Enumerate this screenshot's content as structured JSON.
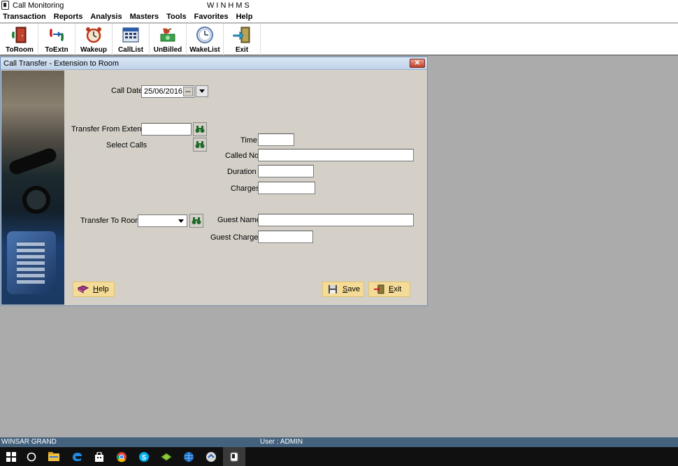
{
  "app": {
    "title": "Call Monitoring",
    "center_title": "WINHMS"
  },
  "menu": [
    "Transaction",
    "Reports",
    "Analysis",
    "Masters",
    "Tools",
    "Favorites",
    "Help"
  ],
  "toolbar": [
    {
      "label": "ToRoom",
      "icon": "transfer-to-room-icon"
    },
    {
      "label": "ToExtn",
      "icon": "transfer-to-extension-icon"
    },
    {
      "label": "Wakeup",
      "icon": "alarm-clock-icon"
    },
    {
      "label": "CallList",
      "icon": "calculator-list-icon"
    },
    {
      "label": "UnBilled",
      "icon": "unbilled-money-icon"
    },
    {
      "label": "WakeList",
      "icon": "clock-icon"
    },
    {
      "label": "Exit",
      "icon": "exit-door-icon"
    }
  ],
  "dialog": {
    "title": "Call Transfer - Extension to Room",
    "call_date_label": "Call Date",
    "call_date_value": "25/06/2016",
    "date_button": "...",
    "transfer_from_label": "Transfer From Extension",
    "transfer_from_value": "",
    "select_calls_label": "Select Calls",
    "time_label": "Time",
    "time_value": "",
    "called_no_label": "Called No",
    "called_no_value": "",
    "duration_label": "Duration",
    "duration_value": "",
    "charges_label": "Charges",
    "charges_value": "",
    "transfer_to_label": "Transfer To  Room",
    "transfer_to_value": "",
    "guest_name_label": "Guest Name",
    "guest_name_value": "",
    "guest_charges_label": "Guest Charges",
    "guest_charges_value": "",
    "help_first": "H",
    "help_rest": "elp",
    "save_first": "S",
    "save_rest": "ave",
    "exit_first": "E",
    "exit_rest": "xit"
  },
  "status": {
    "company": "WINSAR GRAND",
    "user": "User :  ADMIN"
  },
  "taskbar": [
    "start-windows-icon",
    "search-circle-icon",
    "file-explorer-icon",
    "edge-browser-icon",
    "store-icon",
    "chrome-icon",
    "skype-icon",
    "app-icon",
    "app-globe-icon",
    "app-arrow-icon",
    "call-monitoring-app-icon"
  ]
}
